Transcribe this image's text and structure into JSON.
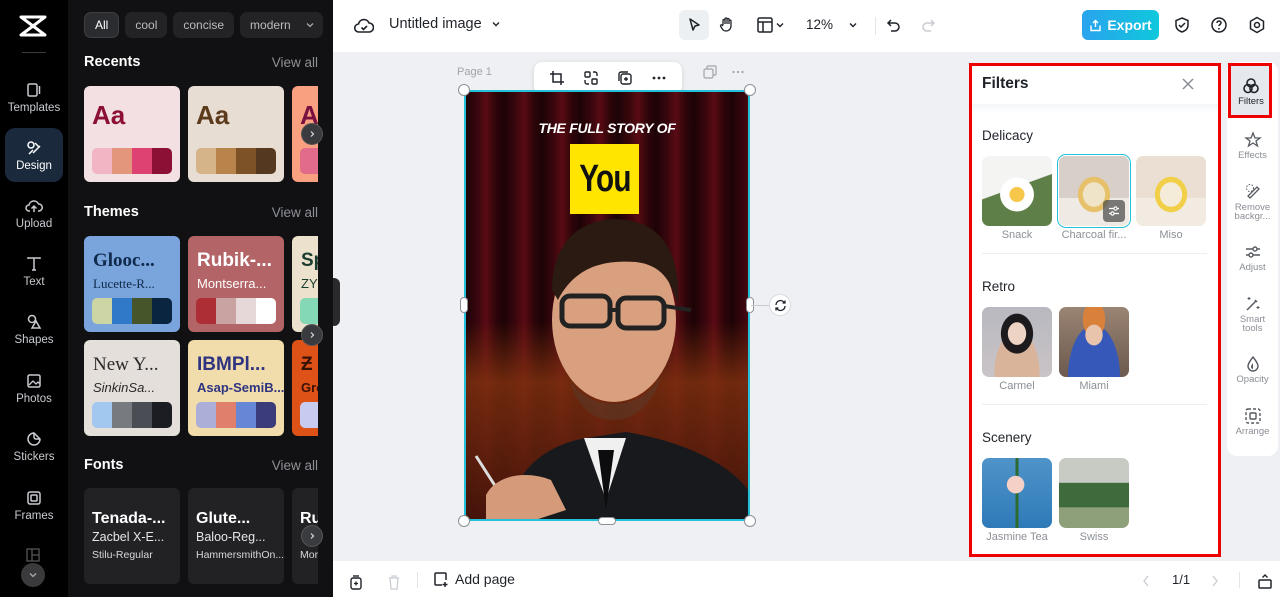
{
  "app": {
    "title": "Untitled image"
  },
  "rail": {
    "items": [
      {
        "label": "Templates",
        "icon": "templates-icon"
      },
      {
        "label": "Design",
        "icon": "design-icon",
        "active": true
      },
      {
        "label": "Upload",
        "icon": "upload-icon"
      },
      {
        "label": "Text",
        "icon": "text-icon"
      },
      {
        "label": "Shapes",
        "icon": "shapes-icon"
      },
      {
        "label": "Photos",
        "icon": "photos-icon"
      },
      {
        "label": "Stickers",
        "icon": "stickers-icon"
      },
      {
        "label": "Frames",
        "icon": "frames-icon"
      }
    ]
  },
  "design_panel": {
    "chips": [
      "All",
      "cool",
      "concise",
      "modern"
    ],
    "recents": {
      "title": "Recents",
      "view_all": "View all",
      "cards": [
        {
          "sample": "Aa",
          "bg": "#f3e0e3",
          "text_color": "#8c1035",
          "palette": [
            "#f2b5c4",
            "#e4967c",
            "#dd4272",
            "#8c1035"
          ]
        },
        {
          "sample": "Aa",
          "bg": "#e8ddd2",
          "text_color": "#5c3a1c",
          "palette": [
            "#d6b48a",
            "#b8844c",
            "#7d5226",
            "#553820"
          ]
        },
        {
          "sample": "A",
          "bg": "#f8a080",
          "text_color": "#7a1040",
          "palette": [
            "#e26b8c",
            "#e26b8c",
            "#e26b8c",
            "#e26b8c"
          ]
        }
      ]
    },
    "themes": {
      "title": "Themes",
      "view_all": "View all",
      "cards": [
        {
          "title": "Glooc...",
          "subtitle": "Lucette-R...",
          "bg": "#79a4dc",
          "color": "#0f2a4a",
          "palette": [
            "#cdd5a4",
            "#3079c8",
            "#46562a",
            "#0a2540"
          ]
        },
        {
          "title": "Rubik-...",
          "subtitle": "Montserra...",
          "bg": "#b36466",
          "color": "#ffffff",
          "palette": [
            "#ad2e35",
            "#c9a2a2",
            "#e6d8d8",
            "#ffffff"
          ]
        },
        {
          "title": "Sp",
          "subtitle": "ZY",
          "bg": "#ece1cc",
          "color": "#1a3b2f",
          "palette": [
            "#84d8b5",
            "#84d8b5",
            "#84d8b5",
            "#84d8b5"
          ]
        },
        {
          "title": "New Y...",
          "subtitle": "SinkinSa...",
          "bg": "#e4dfda",
          "color": "#2a2a2a",
          "palette": [
            "#a3c8ef",
            "#777b80",
            "#4a4d54",
            "#1b1d22"
          ]
        },
        {
          "title": "IBMPl...",
          "subtitle": "Asap-SemiB...",
          "bg": "#f1dcab",
          "color": "#2e3480",
          "palette": [
            "#abaed6",
            "#e07f6c",
            "#6686d6",
            "#3b3d7b"
          ]
        },
        {
          "title": "Ƶ",
          "subtitle": "Gro",
          "bg": "#df5217",
          "color": "#3a1205",
          "palette": [
            "#c8cbf0",
            "#c8cbf0",
            "#c8cbf0",
            "#c8cbf0"
          ]
        }
      ]
    },
    "fonts": {
      "title": "Fonts",
      "view_all": "View all",
      "cards": [
        {
          "line1": "Tenada-...",
          "line2": "Zacbel X-E...",
          "line3": "Stilu-Regular"
        },
        {
          "line1": "Glute...",
          "line2": "Baloo-Reg...",
          "line3": "HammersmithOn..."
        },
        {
          "line1": "Ru",
          "line2": "",
          "line3": "Mor"
        }
      ]
    }
  },
  "topbar": {
    "zoom": "12%",
    "export_label": "Export",
    "accent": "#1fb5e6"
  },
  "canvas": {
    "page_label": "Page 1",
    "headline": "THE FULL STORY OF",
    "highlight": "You",
    "highlight_color": "#ffe500",
    "selection_color": "#22c1d9"
  },
  "filters": {
    "title": "Filters",
    "categories": [
      {
        "name": "Delicacy",
        "items": [
          {
            "label": "Snack"
          },
          {
            "label": "Charcoal fir...",
            "selected": true
          },
          {
            "label": "Miso"
          }
        ]
      },
      {
        "name": "Retro",
        "items": [
          {
            "label": "Carmel"
          },
          {
            "label": "Miami"
          }
        ]
      },
      {
        "name": "Scenery",
        "items": [
          {
            "label": "Jasmine Tea"
          },
          {
            "label": "Swiss"
          }
        ]
      }
    ]
  },
  "right_rail": {
    "items": [
      {
        "label": "Filters",
        "active": true
      },
      {
        "label": "Effects"
      },
      {
        "label": "Remove backgr..."
      },
      {
        "label": "Adjust"
      },
      {
        "label": "Smart tools"
      },
      {
        "label": "Opacity"
      },
      {
        "label": "Arrange"
      }
    ]
  },
  "bottombar": {
    "add_page": "Add page",
    "page_indicator": "1/1"
  },
  "highlight_color": "#ee0000"
}
